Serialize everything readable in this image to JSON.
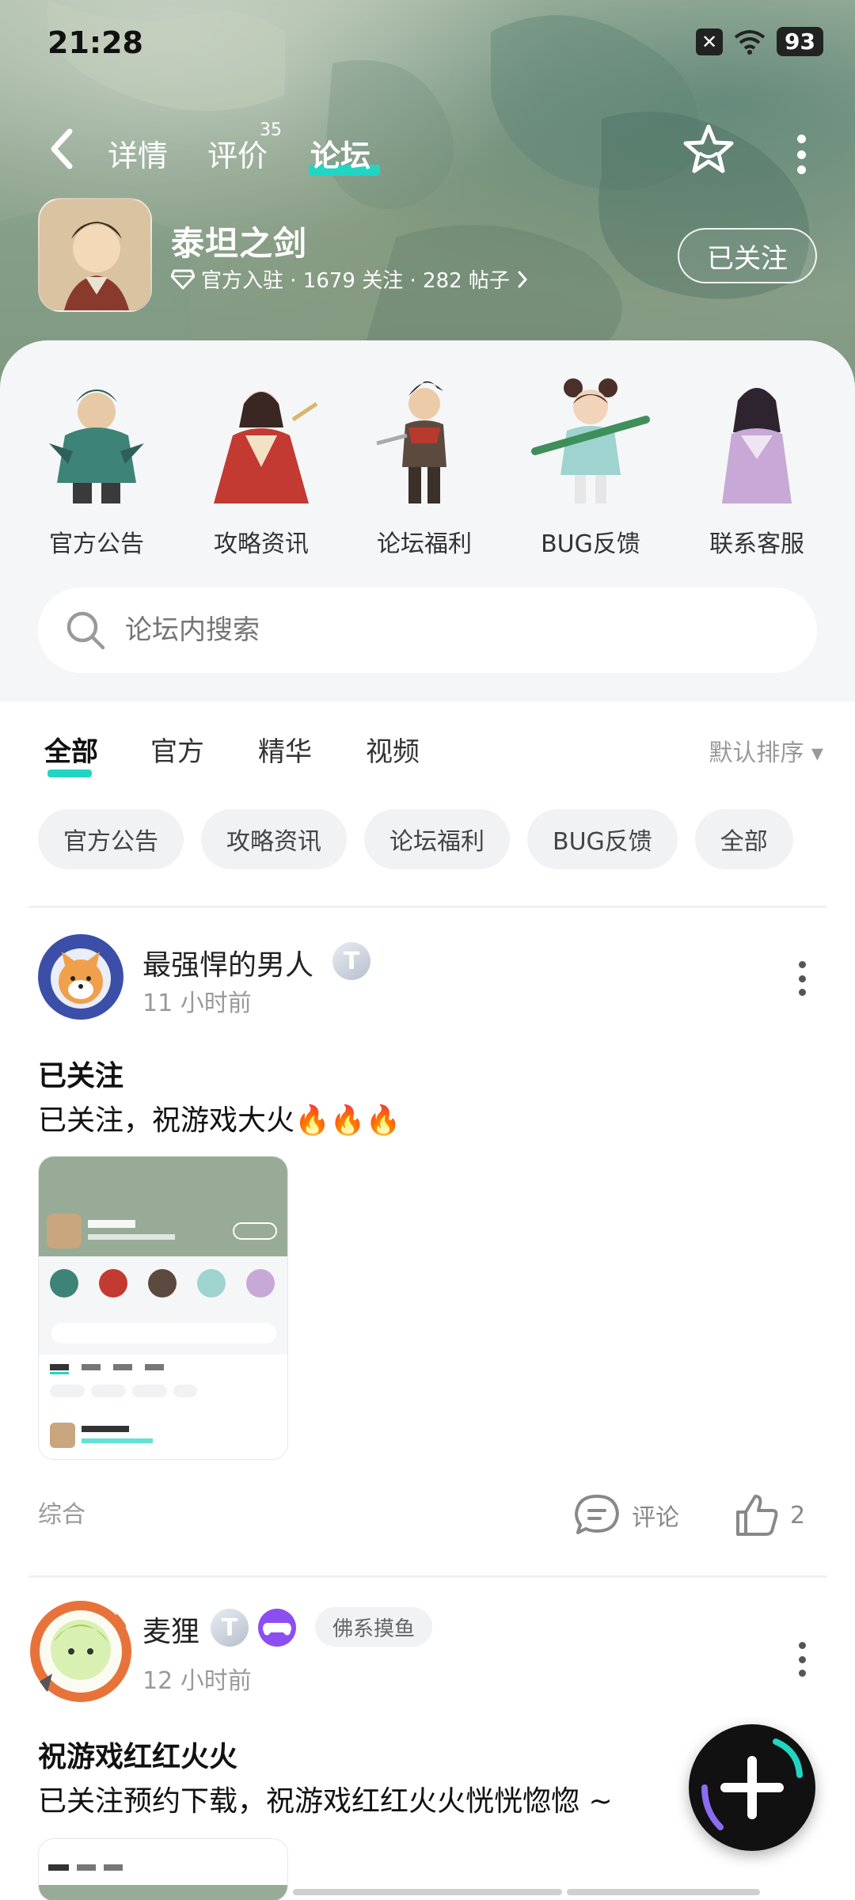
{
  "status_bar": {
    "time": "21:28",
    "battery": "93"
  },
  "nav": {
    "tabs": [
      {
        "label": "详情"
      },
      {
        "label": "评价",
        "count": "35"
      },
      {
        "label": "论坛"
      }
    ]
  },
  "game": {
    "name": "泰坦之剑",
    "meta": "官方入驻 · 1679 关注 · 282 帖子",
    "follow_label": "已关注"
  },
  "categories": [
    {
      "label": "官方公告"
    },
    {
      "label": "攻略资讯"
    },
    {
      "label": "论坛福利"
    },
    {
      "label": "BUG反馈"
    },
    {
      "label": "联系客服"
    }
  ],
  "search": {
    "placeholder": "论坛内搜索"
  },
  "filter_tabs": [
    {
      "label": "全部"
    },
    {
      "label": "官方"
    },
    {
      "label": "精华"
    },
    {
      "label": "视频"
    }
  ],
  "sort_label": "默认排序 ▾",
  "chips": [
    "官方公告",
    "攻略资讯",
    "论坛福利",
    "BUG反馈",
    "全部"
  ],
  "posts": [
    {
      "username": "最强悍的男人",
      "level": "T",
      "time": "11 小时前",
      "title": "已关注",
      "body": "已关注，祝游戏大火🔥🔥🔥",
      "tag": "综合",
      "comment_label": "评论",
      "like_count": "2"
    },
    {
      "username": "麦狸",
      "level": "T",
      "group_tag": "佛系摸鱼",
      "time": "12 小时前",
      "title": "祝游戏红红火火",
      "body": "已关注预约下载，祝游戏红红火火恍恍惚惚 ~"
    }
  ],
  "colors": {
    "accent": "#20d6c3",
    "hero_green": "#8fa58f"
  }
}
